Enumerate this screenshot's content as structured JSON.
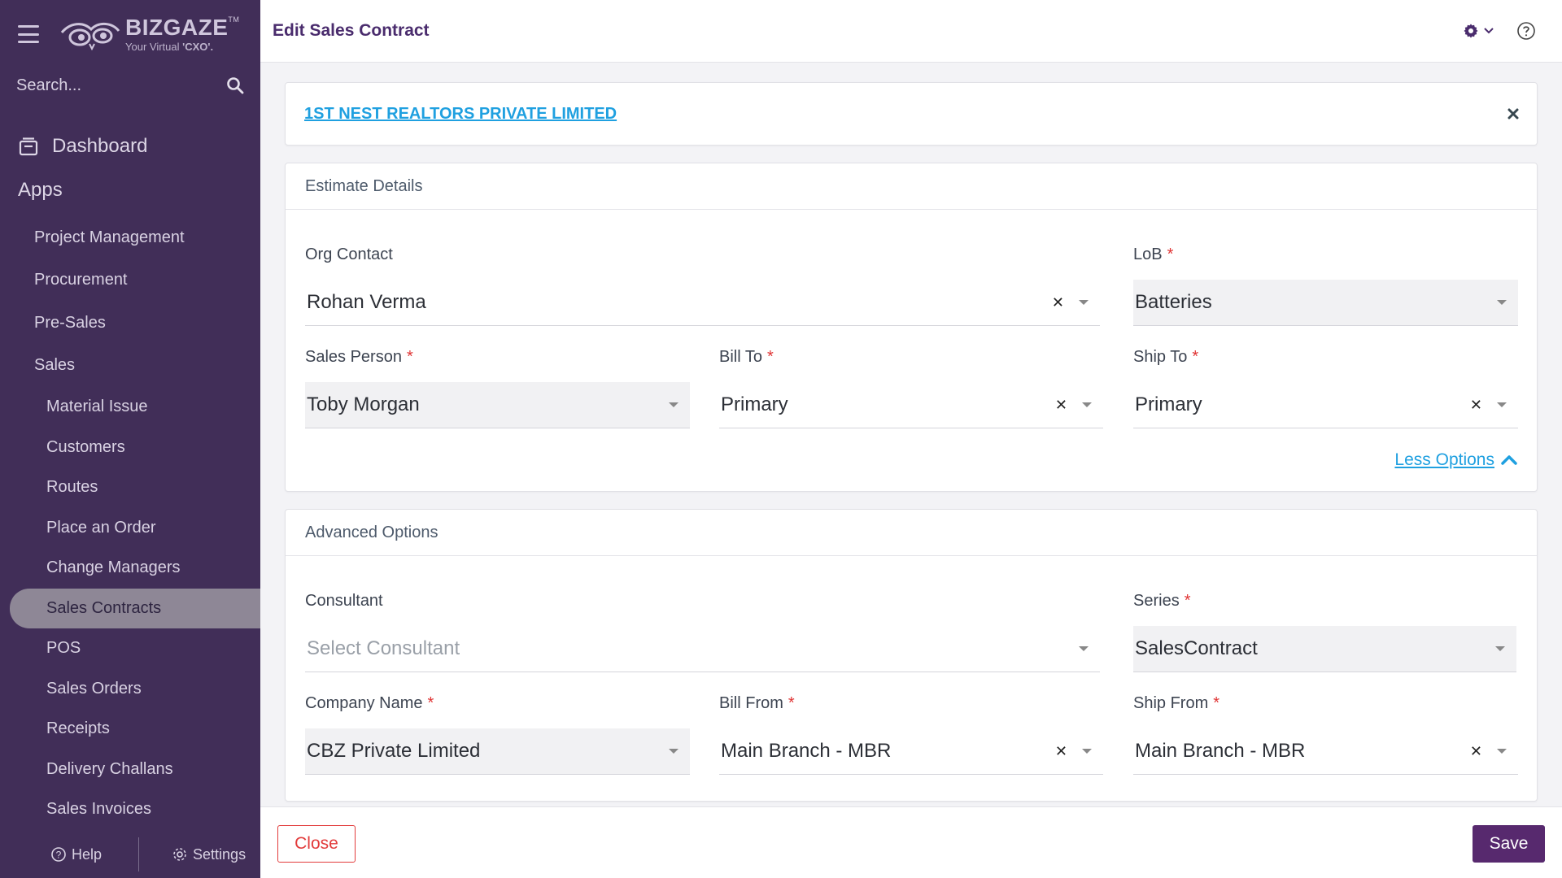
{
  "app": {
    "brand": "BIZGAZE",
    "brand_tm": "TM",
    "tagline_prefix": "Your Virtual",
    "tagline_bold": "'CXO'."
  },
  "sidebar": {
    "search_placeholder": "Search...",
    "dashboard_label": "Dashboard",
    "apps_label": "Apps",
    "top_items": [
      {
        "label": "Project Management"
      },
      {
        "label": "Procurement"
      },
      {
        "label": "Pre-Sales"
      },
      {
        "label": "Sales"
      }
    ],
    "sub_items": [
      {
        "label": "Material Issue"
      },
      {
        "label": "Customers"
      },
      {
        "label": "Routes"
      },
      {
        "label": "Place an Order"
      },
      {
        "label": "Change Managers"
      },
      {
        "label": "Sales Contracts",
        "active": true
      },
      {
        "label": "POS"
      },
      {
        "label": "Sales Orders"
      },
      {
        "label": "Receipts"
      },
      {
        "label": "Delivery Challans"
      },
      {
        "label": "Sales Invoices"
      }
    ],
    "footer": {
      "help_label": "Help",
      "settings_label": "Settings"
    }
  },
  "header": {
    "title": "Edit Sales Contract",
    "icons": [
      "gear-icon",
      "chevron-down-icon",
      "help-circle-icon"
    ]
  },
  "customer": {
    "name": "1ST NEST REALTORS PRIVATE LIMITED"
  },
  "estimate": {
    "section_title": "Estimate Details",
    "org_contact": {
      "label": "Org Contact",
      "value": "Rohan Verma"
    },
    "lob": {
      "label": "LoB",
      "value": "Batteries"
    },
    "sales_person": {
      "label": "Sales Person",
      "value": "Toby Morgan"
    },
    "bill_to": {
      "label": "Bill To",
      "value": "Primary"
    },
    "ship_to": {
      "label": "Ship To",
      "value": "Primary"
    },
    "less_options_label": "Less Options"
  },
  "advanced": {
    "section_title": "Advanced Options",
    "consultant": {
      "label": "Consultant",
      "placeholder": "Select Consultant"
    },
    "series": {
      "label": "Series",
      "value": "SalesContract"
    },
    "company_name": {
      "label": "Company Name",
      "value": "CBZ Private Limited"
    },
    "bill_from": {
      "label": "Bill From",
      "value": "Main Branch - MBR"
    },
    "ship_from": {
      "label": "Ship From",
      "value": "Main Branch - MBR"
    }
  },
  "footer": {
    "close_label": "Close",
    "save_label": "Save"
  },
  "colors": {
    "sidebar_bg": "#412e58",
    "primary": "#57296e",
    "link": "#1fa0e0",
    "danger": "#e23b3b",
    "required": "#e03434"
  }
}
